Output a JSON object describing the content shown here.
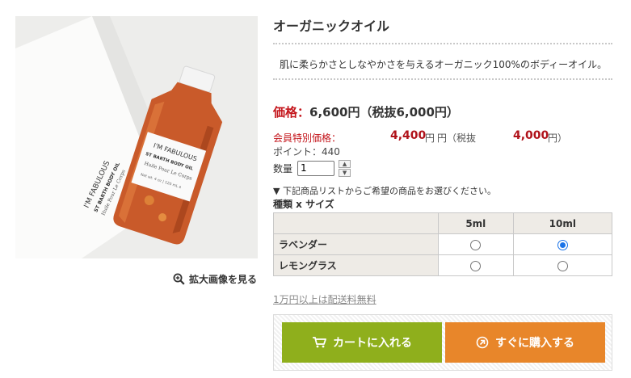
{
  "product": {
    "title": "オーガニックオイル",
    "description": "肌に柔らかさとしなやかさを与えるオーガニック100%のボディーオイル。",
    "bottle_label": {
      "brand": "I'M FABULOUS",
      "name": "ST BARTH BODY OIL",
      "sub": "Huile Pour Le Corps",
      "size": "Net wt. 4 oz | 120 mL e"
    }
  },
  "gallery": {
    "zoom_label": "拡大画像を見る",
    "zoom_icon": "magnifier-plus-icon"
  },
  "pricing": {
    "price_label": "価格：",
    "price_value": "6,600円（税抜6,000円）",
    "member_label": "会員特別価格：",
    "member_price": "4,400",
    "member_yen": "円（税抜",
    "member_tax_value": "4,000",
    "member_yen_close": "円）",
    "points": "ポイント：440"
  },
  "quantity": {
    "label": "数量",
    "value": "1"
  },
  "variants": {
    "notice": "▼ 下記商品リストからご希望の商品をお選びください。",
    "heading": "種類 x サイズ",
    "columns": [
      "5ml",
      "10ml"
    ],
    "rows": [
      {
        "label": "ラベンダー",
        "selected": "10ml"
      },
      {
        "label": "レモングラス",
        "selected": null
      }
    ]
  },
  "shipping_note": "1万円以上は配送料無料",
  "buttons": {
    "cart_label": "カートに入れる",
    "cart_icon": "shopping-cart-icon",
    "buy_label": "すぐに購入する",
    "buy_icon": "circle-arrow-icon"
  },
  "colors": {
    "price_red": "#c4161c",
    "cart_green": "#8faf1c",
    "buy_orange": "#e8862a",
    "table_header_bg": "#eeebe6"
  }
}
